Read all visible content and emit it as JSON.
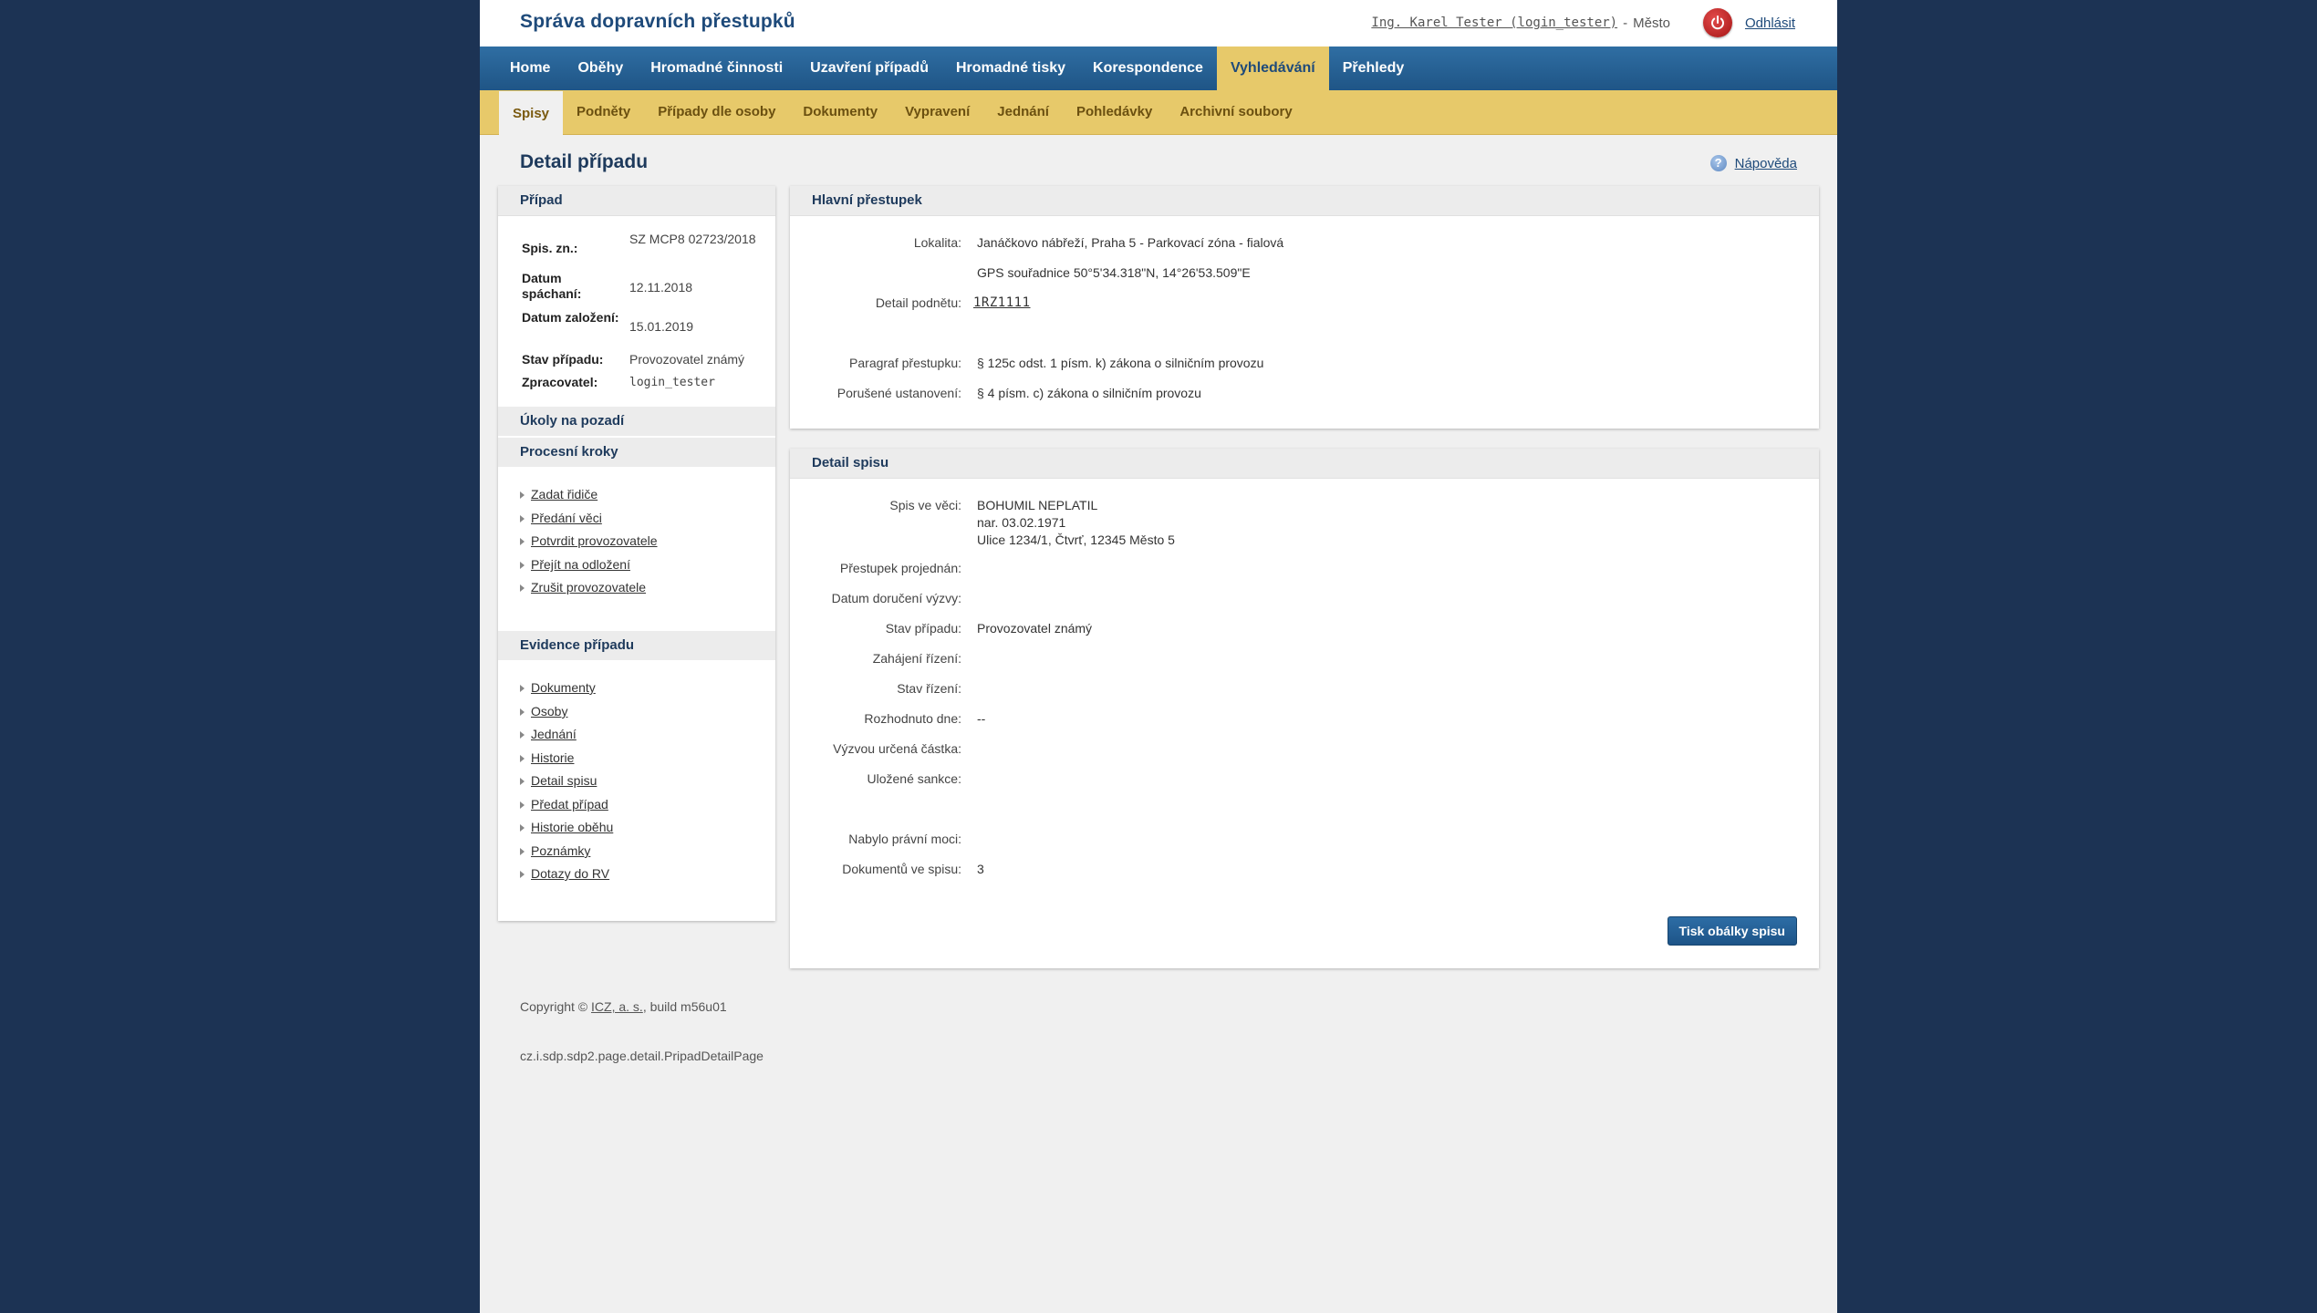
{
  "header": {
    "app_title": "Správa dopravních přestupků",
    "user_link": "Ing. Karel Tester (login_tester)",
    "user_separator": "-",
    "user_city": "Město",
    "logout_label": "Odhlásit"
  },
  "main_nav": [
    {
      "label": "Home",
      "active": false
    },
    {
      "label": "Oběhy",
      "active": false
    },
    {
      "label": "Hromadné činnosti",
      "active": false
    },
    {
      "label": "Uzavření případů",
      "active": false
    },
    {
      "label": "Hromadné tisky",
      "active": false
    },
    {
      "label": "Korespondence",
      "active": false
    },
    {
      "label": "Vyhledávání",
      "active": true
    },
    {
      "label": "Přehledy",
      "active": false
    }
  ],
  "sub_nav": [
    {
      "label": "Spisy",
      "active": true
    },
    {
      "label": "Podněty",
      "active": false
    },
    {
      "label": "Případy dle osoby",
      "active": false
    },
    {
      "label": "Dokumenty",
      "active": false
    },
    {
      "label": "Vypravení",
      "active": false
    },
    {
      "label": "Jednání",
      "active": false
    },
    {
      "label": "Pohledávky",
      "active": false
    },
    {
      "label": "Archivní soubory",
      "active": false
    }
  ],
  "page": {
    "title": "Detail případu",
    "help_label": "Nápověda",
    "help_icon": "question-icon"
  },
  "case": {
    "heading": "Případ",
    "rows": [
      {
        "label": "Spis. zn.:",
        "value": "SZ MCP8 02723/2018"
      },
      {
        "label": "Datum spáchaní:",
        "value": "12.11.2018"
      },
      {
        "label": "Datum založení:",
        "value": "15.01.2019"
      },
      {
        "label": "Stav případu:",
        "value": "Provozovatel známý"
      },
      {
        "label": "Zpracovatel:",
        "value": "login_tester"
      }
    ]
  },
  "background_tasks": {
    "heading": "Úkoly na pozadí"
  },
  "process_steps": {
    "heading": "Procesní kroky",
    "items": [
      "Zadat řidiče",
      "Předání věci",
      "Potvrdit provozovatele",
      "Přejít na odložení",
      "Zrušit provozovatele"
    ]
  },
  "case_records": {
    "heading": "Evidence případu",
    "items": [
      "Dokumenty",
      "Osoby",
      "Jednání",
      "Historie",
      "Detail spisu",
      "Předat případ",
      "Historie oběhu",
      "Poznámky",
      "Dotazy do RV"
    ]
  },
  "main_offence": {
    "heading": "Hlavní přestupek",
    "locality_label": "Lokalita:",
    "locality_value": "Janáčkovo nábřeží, Praha 5 - Parkovací zóna - fialová",
    "gps_value": "GPS souřadnice 50°5'34.318\"N, 14°26'53.509\"E",
    "detail_label": "Detail podnětu:",
    "detail_value": "1RZ1111",
    "paragraph_label": "Paragraf přestupku:",
    "paragraph_value": "§ 125c odst. 1 písm. k) zákona o silničním provozu",
    "violated_label": "Porušené ustanovení:",
    "violated_value": "§ 4 písm. c) zákona o silničním provozu"
  },
  "file_detail": {
    "heading": "Detail spisu",
    "subject_label": "Spis ve věci:",
    "subject_name": "BOHUMIL NEPLATIL",
    "subject_birth": "nar. 03.02.1971",
    "subject_address": "Ulice 1234/1, Čtvrť, 12345 Město 5",
    "fields": [
      {
        "label": "Přestupek projednán:",
        "value": ""
      },
      {
        "label": "Datum doručení výzvy:",
        "value": ""
      },
      {
        "label": "Stav případu:",
        "value": "Provozovatel známý"
      },
      {
        "label": "Zahájení řízení:",
        "value": ""
      },
      {
        "label": "Stav řízení:",
        "value": ""
      },
      {
        "label": "Rozhodnuto dne:",
        "value": "--"
      },
      {
        "label": "Výzvou určená částka:",
        "value": ""
      },
      {
        "label": "Uložené sankce:",
        "value": ""
      },
      {
        "label": "Nabylo právní moci:",
        "value": ""
      },
      {
        "label": "Dokumentů ve spisu:",
        "value": "3"
      }
    ],
    "print_button": "Tisk obálky spisu"
  },
  "footer": {
    "copyright_prefix": "Copyright ©",
    "copyright_link": "ICZ, a. s.",
    "copyright_suffix": ", build m56u01",
    "page_class": "cz.i.sdp.sdp2.page.detail.PripadDetailPage"
  }
}
